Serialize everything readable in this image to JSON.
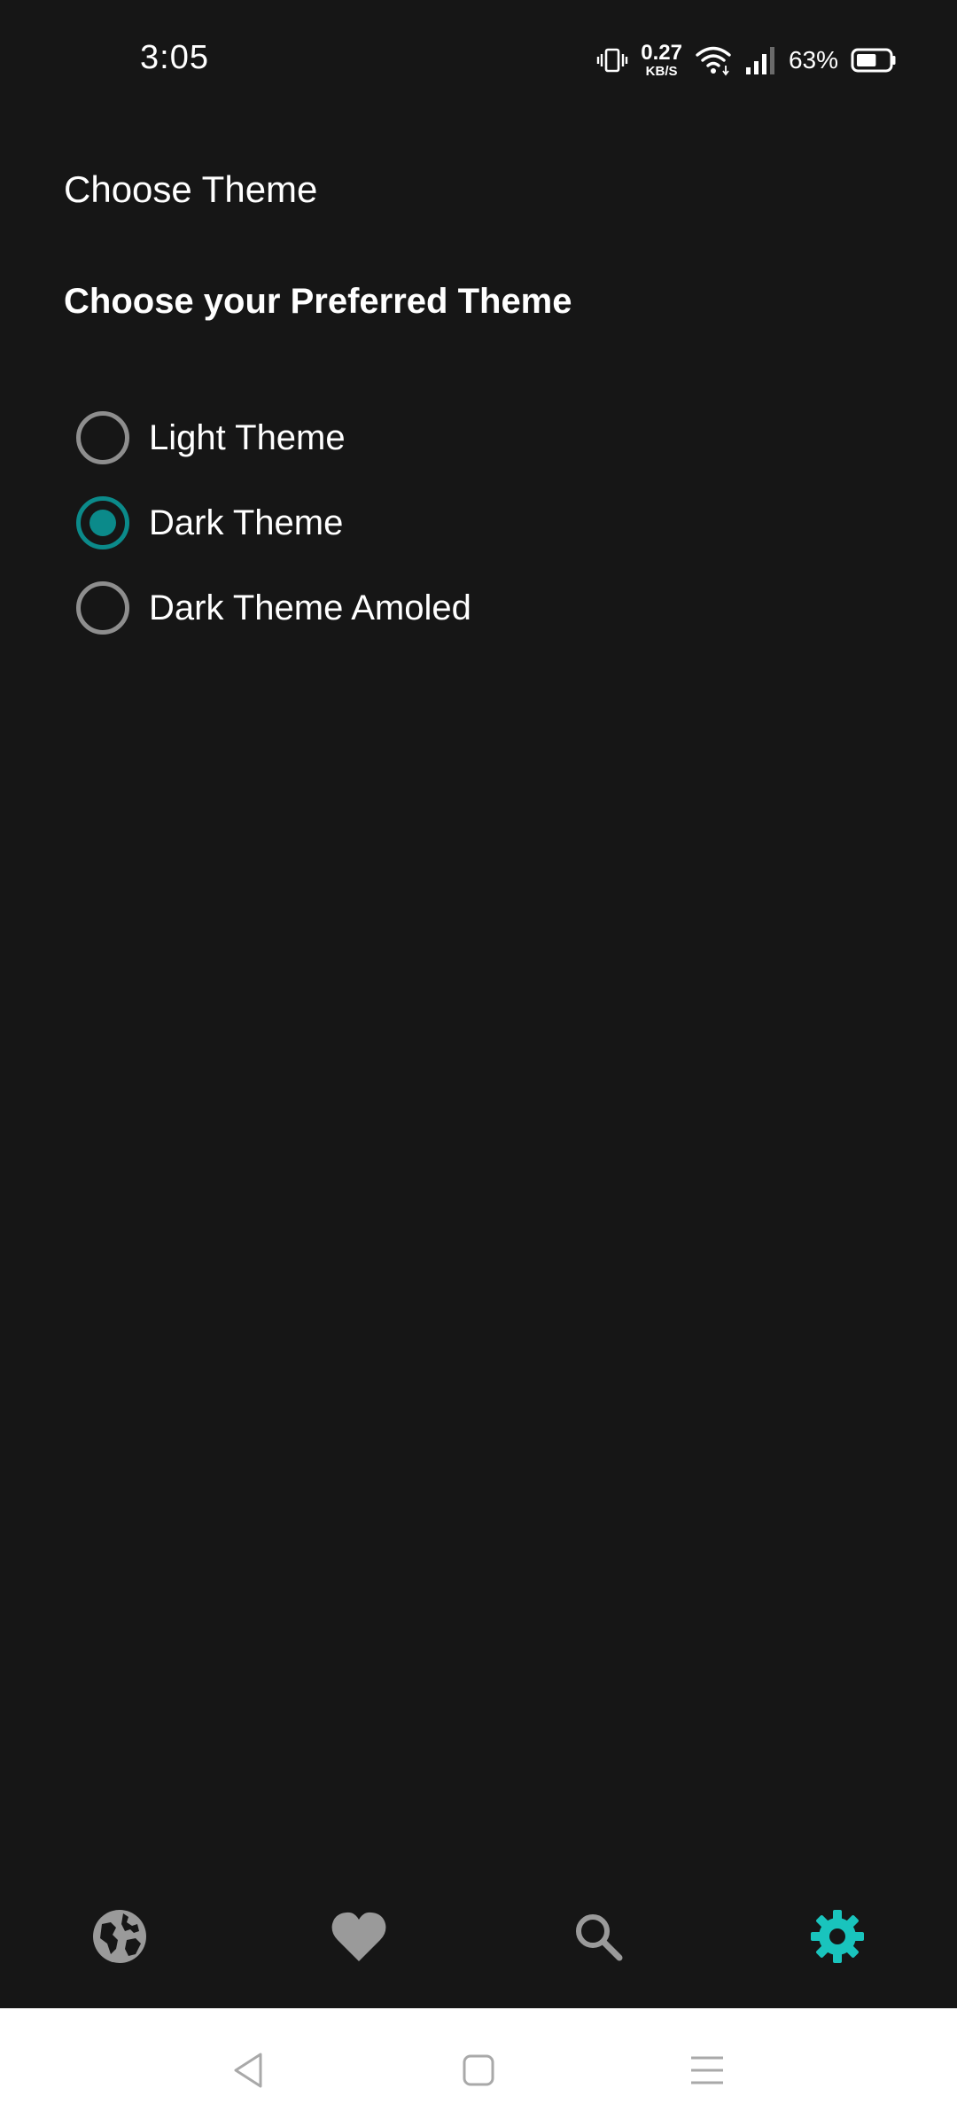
{
  "status_bar": {
    "time": "3:05",
    "net_speed_value": "0.27",
    "net_speed_unit": "KB/S",
    "battery_percent": "63%",
    "icons": [
      "vibrate-icon",
      "wifi-icon",
      "signal-icon",
      "battery-icon"
    ],
    "battery_level": 0.63
  },
  "header": {
    "title": "Choose Theme"
  },
  "theme_section": {
    "heading": "Choose your Preferred Theme",
    "options": [
      {
        "label": "Light Theme",
        "selected": false
      },
      {
        "label": "Dark Theme",
        "selected": true
      },
      {
        "label": "Dark Theme Amoled",
        "selected": false
      }
    ]
  },
  "bottom_nav": {
    "items": [
      {
        "icon": "globe-icon",
        "active": false
      },
      {
        "icon": "heart-icon",
        "active": false
      },
      {
        "icon": "search-icon",
        "active": false
      },
      {
        "icon": "gear-icon",
        "active": true
      }
    ]
  },
  "system_nav": {
    "icons": [
      "back-icon",
      "home-icon",
      "recents-icon"
    ]
  },
  "colors": {
    "background": "#161616",
    "accent": "#0b8a8a",
    "active_nav": "#19c4bd",
    "inactive_icon": "#9a9a9a",
    "radio_unchecked": "#8e8e8e"
  }
}
